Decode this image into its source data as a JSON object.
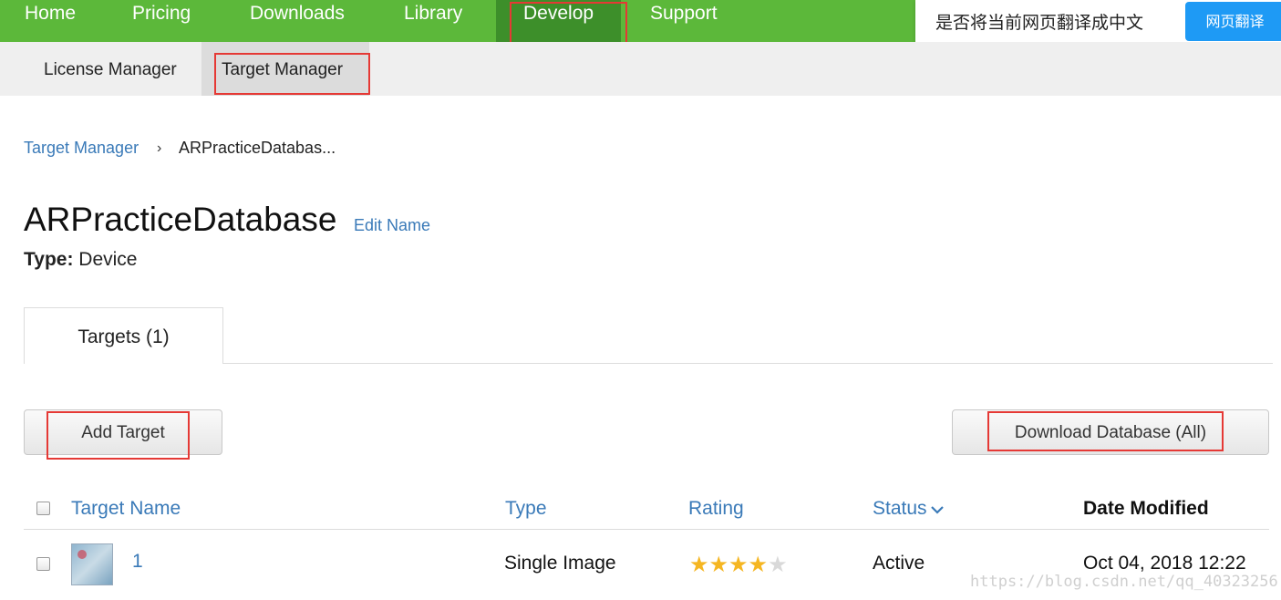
{
  "topnav": {
    "items": [
      "Home",
      "Pricing",
      "Downloads",
      "Library",
      "Develop",
      "Support"
    ],
    "active": "Develop",
    "color": "#5cb83a"
  },
  "translate": {
    "prompt": "是否将当前网页翻译成中文",
    "button": "网页翻译"
  },
  "subnav": {
    "items": [
      "License Manager",
      "Target Manager"
    ],
    "active": "Target Manager"
  },
  "breadcrumb": {
    "link": "Target Manager",
    "separator": "›",
    "current": "ARPracticeDatabas..."
  },
  "database": {
    "name": "ARPracticeDatabase",
    "edit_label": "Edit Name",
    "type_label": "Type:",
    "type_value": "Device"
  },
  "tabs": [
    {
      "label": "Targets (1)"
    }
  ],
  "actions": {
    "add_target": "Add Target",
    "download_db": "Download Database (All)"
  },
  "table": {
    "headers": [
      "Target Name",
      "Type",
      "Rating",
      "Status",
      "Date Modified"
    ],
    "rows": [
      {
        "name": "1",
        "type": "Single Image",
        "rating": 4,
        "rating_max": 5,
        "status": "Active",
        "date": "Oct 04, 2018 12:22"
      }
    ]
  },
  "watermark": "https://blog.csdn.net/qq_40323256"
}
